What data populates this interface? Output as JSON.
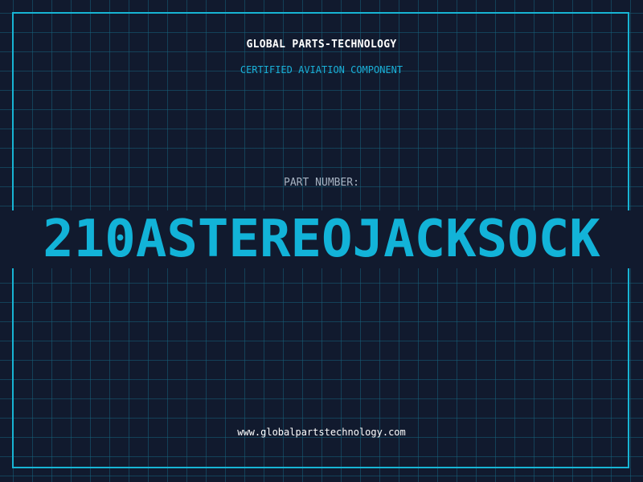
{
  "header": {
    "company": "GLOBAL PARTS-TECHNOLOGY",
    "tagline": "CERTIFIED AVIATION COMPONENT"
  },
  "part": {
    "label": "PART NUMBER:",
    "number": "210ASTEREOJACKSOCK"
  },
  "footer": {
    "website": "www.globalpartstechnology.com"
  },
  "colors": {
    "background": "#111a2e",
    "grid": "#16607a",
    "accent": "#12b3d8",
    "text_primary": "#ffffff",
    "text_muted": "#a7b3c2"
  }
}
